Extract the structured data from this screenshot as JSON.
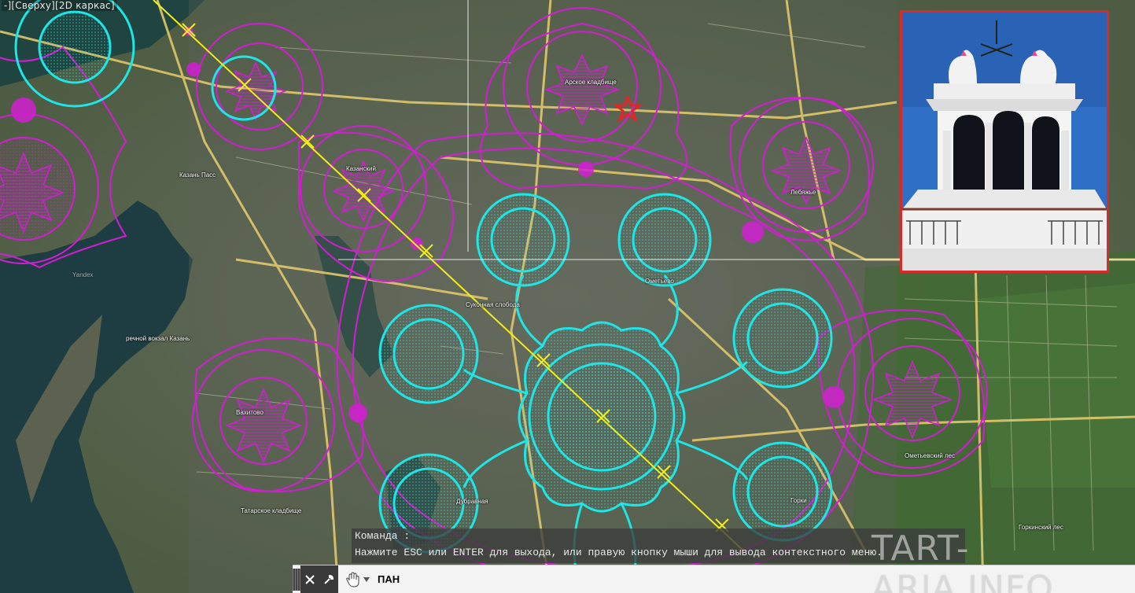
{
  "viewport_label": "-][Сверху][2D каркас]",
  "map_labels": {
    "kazan_pass": "Казань Пасс",
    "river_station": "речной вокзал Казань",
    "tatar_cemetery": "Татарское кладбище",
    "rail": "Вахитово",
    "ometyevo": "Ометьево",
    "ometyevsky_les": "Ометьевский лес",
    "gorkinsky_les": "Горкинский лес",
    "gorki": "Горки",
    "arskoe": "Арское кладбище",
    "sukonnaya": "Суконная слобода",
    "kazanskaya": "Казанский",
    "yandex": "Yandex",
    "dubravnaya": "Дубравная",
    "kirovskaya": "Лебяжье"
  },
  "inset": {
    "title": "tower-photo"
  },
  "command": {
    "history_title": "Команда :",
    "history_line": "Нажмите ESC или ENTER для выхода, или правую кнопку мыши для вывода контекстного меню.",
    "current_input": "ПАН"
  },
  "watermark": "TART-ARIA.INFO",
  "colors": {
    "magenta": "#d21ed2",
    "cyan": "#1ee6e6",
    "yellow": "#f2ec1a",
    "red_marker": "#e3252b"
  }
}
